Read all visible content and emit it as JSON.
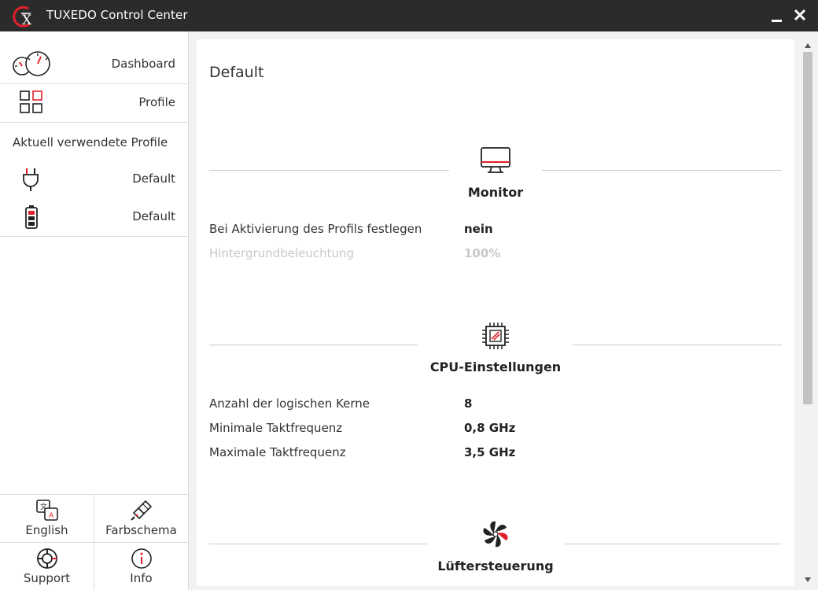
{
  "window": {
    "title": "TUXEDO Control Center",
    "logo_letter": "X"
  },
  "colors": {
    "accent": "#e2202b",
    "titlebar_bg": "#2b2b2b",
    "sidebar_bg": "#ffffff",
    "content_bg": "#f2f2f2"
  },
  "sidebar": {
    "nav": [
      {
        "label": "Dashboard",
        "icon": "speedometer-icon"
      },
      {
        "label": "Profile",
        "icon": "grid-icon"
      }
    ],
    "active_profiles_heading": "Aktuell verwendete Profile",
    "active_profiles": [
      {
        "label": "Default",
        "icon": "power-plug-icon"
      },
      {
        "label": "Default",
        "icon": "battery-icon"
      }
    ],
    "bottom": [
      {
        "label": "English",
        "icon": "translate-icon"
      },
      {
        "label": "Farbschema",
        "icon": "paintbrush-icon"
      },
      {
        "label": "Support",
        "icon": "lifebuoy-icon"
      },
      {
        "label": "Info",
        "icon": "info-icon"
      }
    ]
  },
  "main": {
    "title": "Default",
    "sections": [
      {
        "heading": "Monitor",
        "icon": "monitor-icon",
        "rows": [
          {
            "key": "Bei Aktivierung des Profils festlegen",
            "value": "nein",
            "disabled": false
          },
          {
            "key": "Hintergrundbeleuchtung",
            "value": "100%",
            "disabled": true
          }
        ]
      },
      {
        "heading": "CPU-Einstellungen",
        "icon": "cpu-chip-icon",
        "rows": [
          {
            "key": "Anzahl der logischen Kerne",
            "value": "8",
            "disabled": false
          },
          {
            "key": "Minimale Taktfrequenz",
            "value": "0,8 GHz",
            "disabled": false
          },
          {
            "key": "Maximale Taktfrequenz",
            "value": "3,5 GHz",
            "disabled": false
          }
        ]
      },
      {
        "heading": "Lüftersteuerung",
        "icon": "fan-icon",
        "rows": []
      }
    ]
  }
}
